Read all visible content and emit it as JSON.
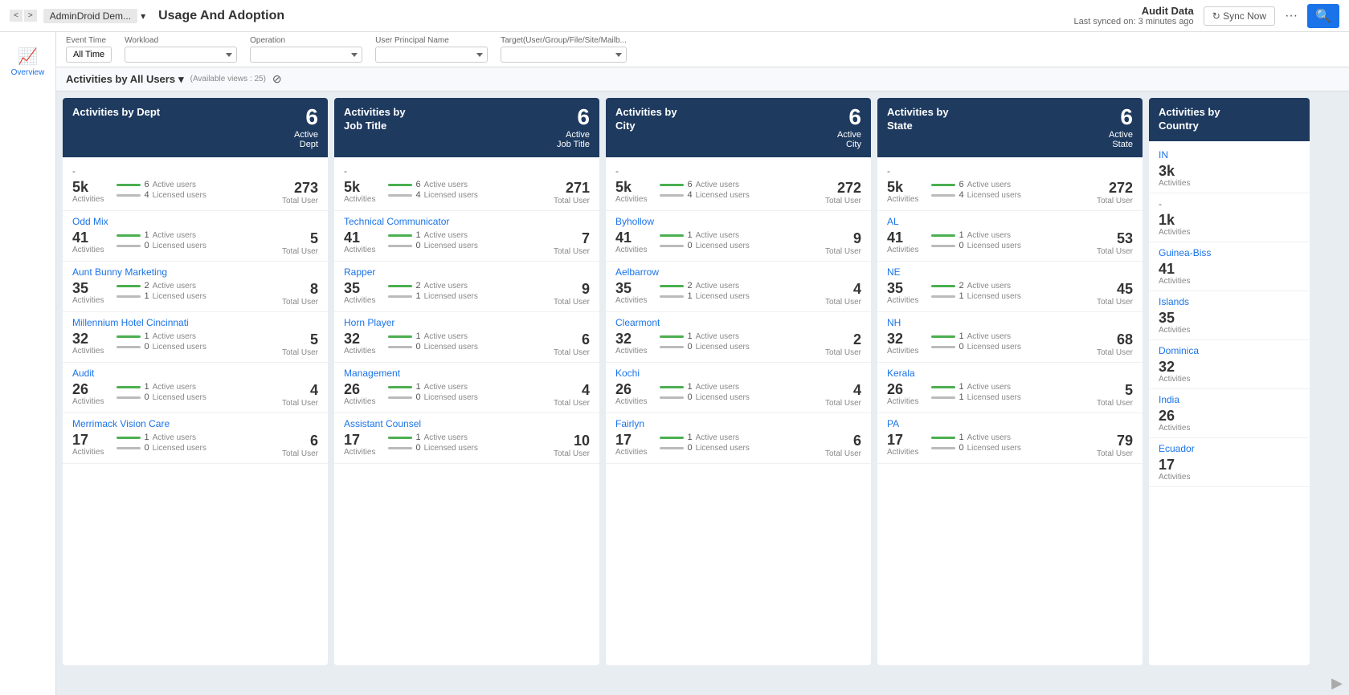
{
  "topbar": {
    "nav_prev": "<",
    "nav_next": ">",
    "breadcrumb_admin": "AdminDroid Dem...",
    "breadcrumb_dropdown": "▾",
    "page_title": "Usage And Adoption",
    "audit_title": "Audit Data",
    "audit_sub": "Last synced on: 3 minutes ago",
    "sync_label": "↻ Sync Now",
    "more_label": "···",
    "search_label": "🔍"
  },
  "filter_bar": {
    "event_time_label": "Event Time",
    "event_time_value": "All Time",
    "workload_label": "Workload",
    "workload_placeholder": "",
    "operation_label": "Operation",
    "operation_placeholder": "",
    "upn_label": "User Principal Name",
    "upn_placeholder": "",
    "target_label": "Target(User/Group/File/Site/Mailb...",
    "target_placeholder": ""
  },
  "view_header": {
    "label": "Activities by All Users",
    "dropdown": "▾",
    "available": "(Available views : 25)",
    "filter_icon": "⊘"
  },
  "sidebar": {
    "icon": "📈",
    "label": "Overview"
  },
  "cards": [
    {
      "id": "dept",
      "header_title": "Activities by Dept",
      "header_count": "6",
      "header_type": "Active\nDept",
      "entries": [
        {
          "name": "-",
          "dash": true,
          "activities": "5k",
          "active_users": "6",
          "licensed_users": "4",
          "total": "273",
          "total_label": "Total User"
        },
        {
          "name": "Odd Mix",
          "activities": "41",
          "active_users": "1",
          "licensed_users": "0",
          "total": "5",
          "total_label": "Total User"
        },
        {
          "name": "Aunt Bunny Marketing",
          "activities": "35",
          "active_users": "2",
          "licensed_users": "1",
          "total": "8",
          "total_label": "Total User"
        },
        {
          "name": "Millennium Hotel Cincinnati",
          "activities": "32",
          "active_users": "1",
          "licensed_users": "0",
          "total": "5",
          "total_label": "Total User"
        },
        {
          "name": "Audit",
          "activities": "26",
          "active_users": "1",
          "licensed_users": "0",
          "total": "4",
          "total_label": "Total User"
        },
        {
          "name": "Merrimack Vision Care",
          "activities": "17",
          "active_users": "1",
          "licensed_users": "0",
          "total": "6",
          "total_label": "Total User"
        }
      ]
    },
    {
      "id": "jobtitle",
      "header_title": "Activities by\nJob Title",
      "header_count": "6",
      "header_type": "Active\nJob Title",
      "entries": [
        {
          "name": "-",
          "dash": true,
          "activities": "5k",
          "active_users": "6",
          "licensed_users": "4",
          "total": "271",
          "total_label": "Total User"
        },
        {
          "name": "Technical Communicator",
          "activities": "41",
          "active_users": "1",
          "licensed_users": "0",
          "total": "7",
          "total_label": "Total User"
        },
        {
          "name": "Rapper",
          "activities": "35",
          "active_users": "2",
          "licensed_users": "1",
          "total": "9",
          "total_label": "Total User"
        },
        {
          "name": "Horn Player",
          "activities": "32",
          "active_users": "1",
          "licensed_users": "0",
          "total": "6",
          "total_label": "Total User"
        },
        {
          "name": "Management",
          "activities": "26",
          "active_users": "1",
          "licensed_users": "0",
          "total": "4",
          "total_label": "Total User"
        },
        {
          "name": "Assistant Counsel",
          "activities": "17",
          "active_users": "1",
          "licensed_users": "0",
          "total": "10",
          "total_label": "Total User"
        }
      ]
    },
    {
      "id": "city",
      "header_title": "Activities by\nCity",
      "header_count": "6",
      "header_type": "Active\nCity",
      "entries": [
        {
          "name": "-",
          "dash": true,
          "activities": "5k",
          "active_users": "6",
          "licensed_users": "4",
          "total": "272",
          "total_label": "Total User"
        },
        {
          "name": "Byhollow",
          "activities": "41",
          "active_users": "1",
          "licensed_users": "0",
          "total": "9",
          "total_label": "Total User"
        },
        {
          "name": "Aelbarrow",
          "activities": "35",
          "active_users": "2",
          "licensed_users": "1",
          "total": "4",
          "total_label": "Total User"
        },
        {
          "name": "Clearmont",
          "activities": "32",
          "active_users": "1",
          "licensed_users": "0",
          "total": "2",
          "total_label": "Total User"
        },
        {
          "name": "Kochi",
          "activities": "26",
          "active_users": "1",
          "licensed_users": "0",
          "total": "4",
          "total_label": "Total User"
        },
        {
          "name": "Fairlyn",
          "activities": "17",
          "active_users": "1",
          "licensed_users": "0",
          "total": "6",
          "total_label": "Total User"
        }
      ]
    },
    {
      "id": "state",
      "header_title": "Activities by\nState",
      "header_count": "6",
      "header_type": "Active\nState",
      "entries": [
        {
          "name": "-",
          "dash": true,
          "activities": "5k",
          "active_users": "6",
          "licensed_users": "4",
          "total": "272",
          "total_label": "Total User"
        },
        {
          "name": "AL",
          "activities": "41",
          "active_users": "1",
          "licensed_users": "0",
          "total": "53",
          "total_label": "Total User"
        },
        {
          "name": "NE",
          "activities": "35",
          "active_users": "2",
          "licensed_users": "1",
          "total": "45",
          "total_label": "Total User"
        },
        {
          "name": "NH",
          "activities": "32",
          "active_users": "1",
          "licensed_users": "0",
          "total": "68",
          "total_label": "Total User"
        },
        {
          "name": "Kerala",
          "activities": "26",
          "active_users": "1",
          "licensed_users": "1",
          "total": "5",
          "total_label": "Total User"
        },
        {
          "name": "PA",
          "activities": "17",
          "active_users": "1",
          "licensed_users": "0",
          "total": "79",
          "total_label": "Total User"
        }
      ]
    },
    {
      "id": "country",
      "header_title": "Activities by\nCountry",
      "header_count": "",
      "header_type": "",
      "is_last": true,
      "entries": [
        {
          "name": "IN",
          "activities": "3k",
          "activities_label": "Activities"
        },
        {
          "name": "-",
          "dash": true,
          "activities": "1k",
          "activities_label": "Activities"
        },
        {
          "name": "Guinea-Biss",
          "activities": "41",
          "activities_label": "Activities"
        },
        {
          "name": "Islands",
          "activities": "35",
          "activities_label": "Activities"
        },
        {
          "name": "Dominica",
          "activities": "32",
          "activities_label": "Activities"
        },
        {
          "name": "India",
          "activities": "26",
          "activities_label": "Activities"
        },
        {
          "name": "Ecuador",
          "activities": "17",
          "activities_label": "Activities"
        }
      ]
    }
  ]
}
